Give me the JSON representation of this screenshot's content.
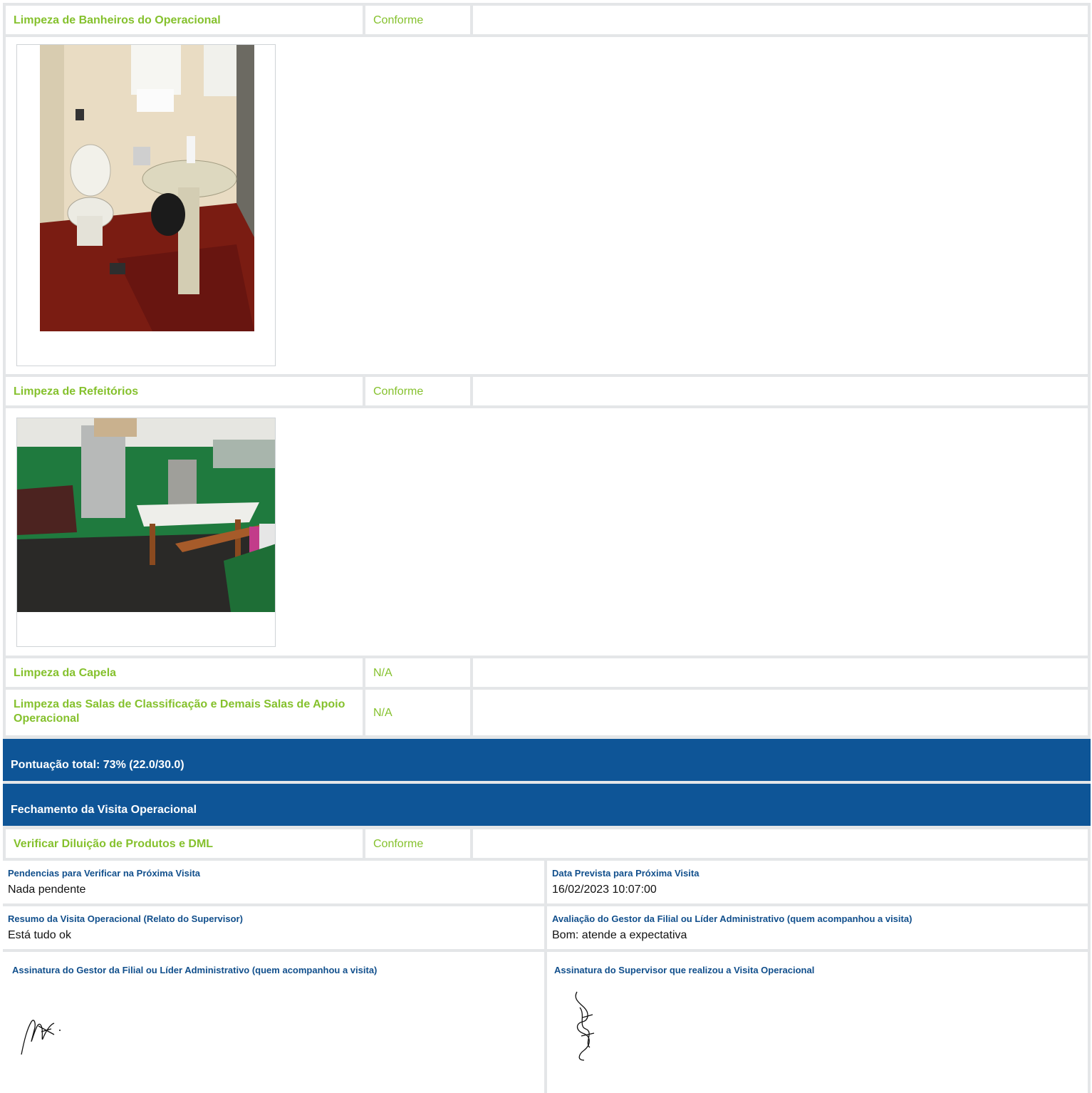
{
  "items": [
    {
      "title": "Limpeza de Banheiros do Operacional",
      "status": "Conforme"
    },
    {
      "title": "Limpeza de Refeitórios",
      "status": "Conforme"
    },
    {
      "title": "Limpeza da Capela",
      "status": "N/A"
    },
    {
      "title": "Limpeza das Salas de Classificação e Demais Salas de Apoio Operacional",
      "status": "N/A"
    }
  ],
  "score": {
    "label": "Pontuação total: 73% (22.0/30.0)"
  },
  "closing": {
    "section_title": "Fechamento da Visita Operacional",
    "item": {
      "title": "Verificar Diluição de Produtos e DML",
      "status": "Conforme"
    },
    "fields": [
      {
        "label": "Pendencias para Verificar na Próxima Visita",
        "value": "Nada pendente"
      },
      {
        "label": "Data Prevista para Próxima Visita",
        "value": "16/02/2023 10:07:00"
      },
      {
        "label": "Resumo da Visita Operacional (Relato do Supervisor)",
        "value": "Está tudo ok"
      },
      {
        "label": "Avaliação do Gestor da Filial ou Líder Administrativo (quem acompanhou a visita)",
        "value": "Bom: atende a expectativa"
      }
    ],
    "signatures": [
      {
        "label": "Assinatura do Gestor da Filial ou Líder Administrativo (quem acompanhou a visita)"
      },
      {
        "label": "Assinatura do Supervisor que realizou a Visita Operacional"
      }
    ]
  },
  "colors": {
    "accent_green": "#85c12d",
    "band_blue": "#0e5597",
    "label_blue": "#114f8c",
    "border": "#e4e6e8"
  }
}
